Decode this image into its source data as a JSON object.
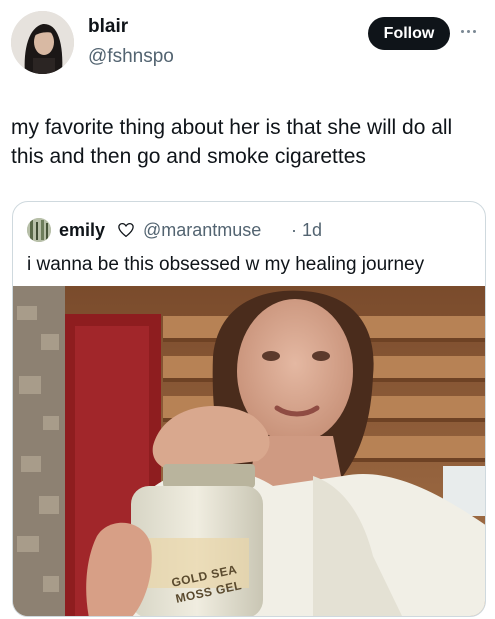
{
  "tweet": {
    "author_name": "blair",
    "author_handle": "@fshnspo",
    "follow_label": "Follow",
    "more_icon": "more-horizontal-icon",
    "text": "my favorite thing about her is that she will do all this and then go and smoke cigarettes"
  },
  "quoted": {
    "author_name": "emily",
    "badge_icon": "heart-icon",
    "author_handle": "@marantmuse",
    "separator": "·",
    "time": "1d",
    "text": "i wanna be this obsessed w my healing journey",
    "media": {
      "type": "video-still",
      "jar_label_line1": "GOLD SEA",
      "jar_label_line2": "MOSS GEL"
    }
  },
  "colors": {
    "text_primary": "#0f1419",
    "text_secondary": "#536471",
    "button_bg": "#0f1419",
    "border": "#cfd9de"
  }
}
